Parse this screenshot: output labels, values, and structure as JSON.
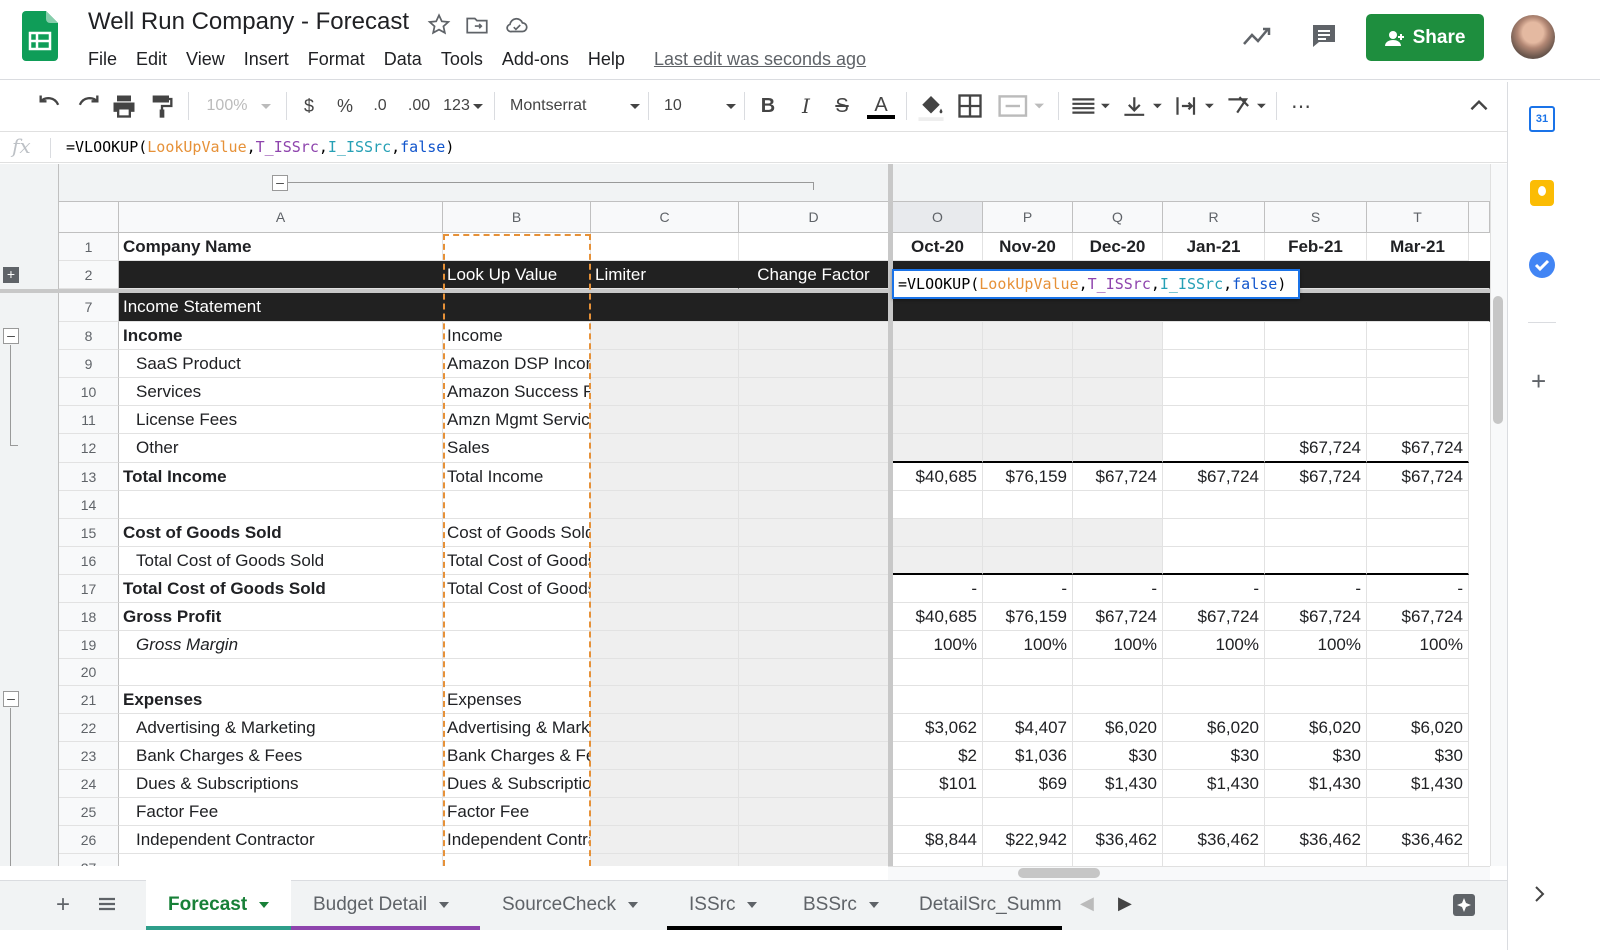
{
  "app": {
    "title": "Well Run Company - Forecast",
    "last_edit": "Last edit was seconds ago",
    "share_label": "Share",
    "menu": [
      "File",
      "Edit",
      "View",
      "Insert",
      "Format",
      "Data",
      "Tools",
      "Add-ons",
      "Help"
    ]
  },
  "toolbar": {
    "zoom": "100%",
    "currency": "$",
    "percent": "%",
    "dec_less": ".0",
    "dec_more": ".00",
    "format_more": "123",
    "font": "Montserrat",
    "font_size": "10",
    "more": "⋯"
  },
  "formula_bar": {
    "fx": "fx",
    "parts": [
      "=VLOOKUP(",
      "LookUpValue",
      ",",
      "T_ISSrc",
      ",",
      "I_ISSrc",
      ",",
      "false",
      ")"
    ]
  },
  "grid": {
    "columns": [
      "A",
      "B",
      "C",
      "D",
      "O",
      "P",
      "Q",
      "R",
      "S",
      "T"
    ],
    "row1": {
      "num": "1",
      "a": "Company Name",
      "months": [
        "Oct-20",
        "Nov-20",
        "Dec-20",
        "Jan-21",
        "Feb-21",
        "Mar-21"
      ]
    },
    "row2": {
      "num": "2",
      "b": "Look Up Value",
      "c": "Limiter",
      "d": "Change Factor"
    },
    "row7": {
      "num": "7",
      "a": "Income Statement"
    },
    "rows": [
      {
        "num": "8",
        "a": "Income",
        "b": "Income",
        "bold": true,
        "vals": [
          "",
          "",
          "",
          "",
          "",
          ""
        ]
      },
      {
        "num": "9",
        "a": "SaaS Product",
        "b": "Amazon DSP Income",
        "indent": true,
        "vals": [
          "",
          "",
          "",
          "",
          "",
          ""
        ]
      },
      {
        "num": "10",
        "a": "Services",
        "b": "Amazon Success Fee",
        "indent": true,
        "vals": [
          "",
          "",
          "",
          "",
          "",
          ""
        ]
      },
      {
        "num": "11",
        "a": "License Fees",
        "b": "Amzn Mgmt Service",
        "indent": true,
        "vals": [
          "",
          "",
          "",
          "",
          "",
          ""
        ]
      },
      {
        "num": "12",
        "a": "Other",
        "b": "Sales",
        "indent": true,
        "vals": [
          "",
          "",
          "",
          "",
          "$67,724",
          "$67,724"
        ]
      },
      {
        "num": "13",
        "a": "Total Income",
        "b": "Total Income",
        "bold": true,
        "vals": [
          "$40,685",
          "$76,159",
          "$67,724",
          "$67,724",
          "$67,724",
          "$67,724"
        ]
      },
      {
        "num": "14",
        "a": "",
        "b": "",
        "vals": [
          "",
          "",
          "",
          "",
          "",
          ""
        ]
      },
      {
        "num": "15",
        "a": "Cost of Goods Sold",
        "b": "Cost of Goods Sold",
        "bold": true,
        "vals": [
          "",
          "",
          "",
          "",
          "",
          ""
        ]
      },
      {
        "num": "16",
        "a": "Total Cost of Goods Sold",
        "b": "Total Cost of Goods Sold",
        "indent": true,
        "vals": [
          "",
          "",
          "",
          "",
          "",
          ""
        ]
      },
      {
        "num": "17",
        "a": "Total Cost of Goods Sold",
        "b": "Total Cost of Goods Sold",
        "bold": true,
        "vals": [
          "-",
          "-",
          "-",
          "-",
          "-",
          "-"
        ]
      },
      {
        "num": "18",
        "a": "Gross Profit",
        "b": "",
        "bold": true,
        "vals": [
          "$40,685",
          "$76,159",
          "$67,724",
          "$67,724",
          "$67,724",
          "$67,724"
        ]
      },
      {
        "num": "19",
        "a": "Gross Margin",
        "b": "",
        "indent": true,
        "italic": true,
        "vals": [
          "100%",
          "100%",
          "100%",
          "100%",
          "100%",
          "100%"
        ]
      },
      {
        "num": "20",
        "a": "",
        "b": "",
        "vals": [
          "",
          "",
          "",
          "",
          "",
          ""
        ]
      },
      {
        "num": "21",
        "a": "Expenses",
        "b": "Expenses",
        "bold": true,
        "vals": [
          "",
          "",
          "",
          "",
          "",
          ""
        ]
      },
      {
        "num": "22",
        "a": "Advertising & Marketing",
        "b": "Advertising & Marketing",
        "indent": true,
        "vals": [
          "$3,062",
          "$4,407",
          "$6,020",
          "$6,020",
          "$6,020",
          "$6,020"
        ]
      },
      {
        "num": "23",
        "a": "Bank Charges & Fees",
        "b": "Bank Charges & Fees",
        "indent": true,
        "vals": [
          "$2",
          "$1,036",
          "$30",
          "$30",
          "$30",
          "$30"
        ]
      },
      {
        "num": "24",
        "a": "Dues & Subscriptions",
        "b": "Dues & Subscriptions",
        "indent": true,
        "vals": [
          "$101",
          "$69",
          "$1,430",
          "$1,430",
          "$1,430",
          "$1,430"
        ]
      },
      {
        "num": "25",
        "a": "Factor Fee",
        "b": "Factor Fee",
        "indent": true,
        "vals": [
          "",
          "",
          "",
          "",
          "",
          ""
        ]
      },
      {
        "num": "26",
        "a": "Independent Contractor",
        "b": "Independent Contractor",
        "indent": true,
        "vals": [
          "$8,844",
          "$22,942",
          "$36,462",
          "$36,462",
          "$36,462",
          "$36,462"
        ]
      },
      {
        "num": "27",
        "a": "",
        "b": "",
        "vals": [
          "",
          "",
          "",
          "",
          "",
          ""
        ]
      }
    ]
  },
  "sheet_tabs": [
    {
      "label": "Forecast",
      "active": true,
      "color": "#2e9e8a"
    },
    {
      "label": "Budget Detail",
      "active": false,
      "color": "#8e44ad"
    },
    {
      "label": "SourceCheck",
      "active": false,
      "color": ""
    },
    {
      "label": "ISSrc",
      "active": false,
      "color": "#000000"
    },
    {
      "label": "BSSrc",
      "active": false,
      "color": "#000000"
    },
    {
      "label": "DetailSrc_Summ",
      "active": false,
      "color": "#000000"
    }
  ],
  "side_panel": {
    "calendar_day": "31"
  },
  "colors": {
    "share_green": "#1e8e3e",
    "header_dark": "#212121",
    "selection_blue": "#1a73e8",
    "lookup_dash": "#e69138"
  }
}
